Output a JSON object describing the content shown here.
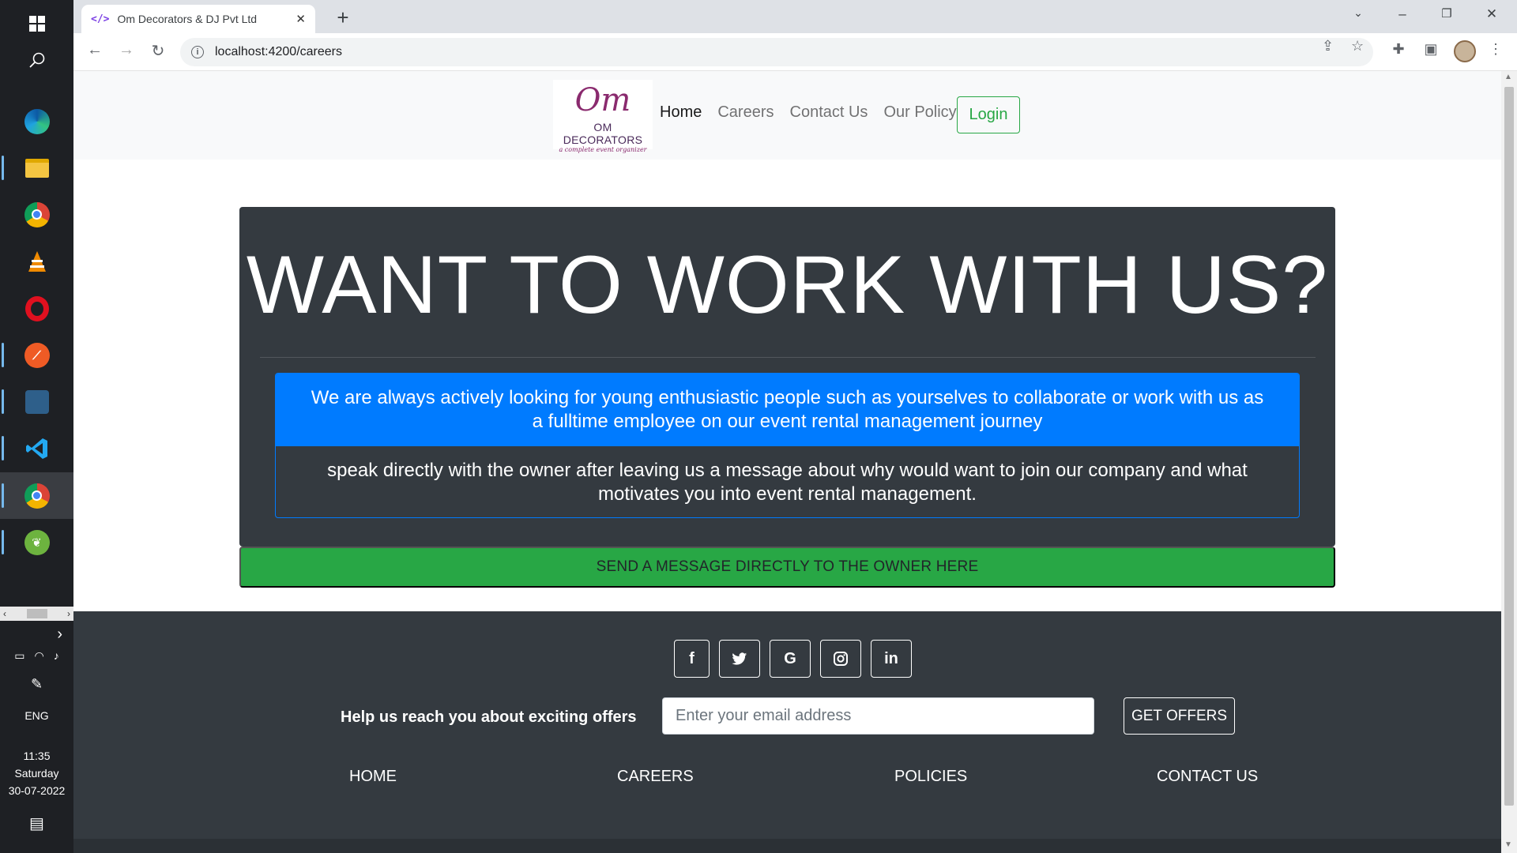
{
  "taskbar": {
    "apps": [
      {
        "name": "windows-start",
        "icon": "windows-logo-icon"
      },
      {
        "name": "search",
        "icon": "search-icon"
      },
      {
        "name": "edge",
        "icon": "edge-icon"
      },
      {
        "name": "file-explorer",
        "icon": "folder-icon"
      },
      {
        "name": "chrome",
        "icon": "chrome-icon"
      },
      {
        "name": "vlc",
        "icon": "vlc-cone-icon"
      },
      {
        "name": "opera",
        "icon": "opera-icon"
      },
      {
        "name": "postman",
        "icon": "postman-icon"
      },
      {
        "name": "mysql-workbench",
        "icon": "mysql-workbench-icon"
      },
      {
        "name": "vscode",
        "icon": "vscode-icon"
      },
      {
        "name": "chrome-active",
        "icon": "chrome-icon"
      },
      {
        "name": "spring-tool-suite",
        "icon": "spring-icon"
      }
    ],
    "language": "ENG",
    "time": "11:35",
    "day": "Saturday",
    "date": "30-07-2022"
  },
  "browser": {
    "tab_title": "Om Decorators & DJ Pvt Ltd",
    "tab_favicon": "</>",
    "url": "localhost:4200/careers"
  },
  "site": {
    "logo": {
      "mark": "Om",
      "brand": "OM DECORATORS",
      "tagline": "a complete event organizer"
    },
    "nav": {
      "home": "Home",
      "careers": "Careers",
      "contact": "Contact Us",
      "policy": "Our Policy",
      "login": "Login"
    },
    "hero": {
      "heading": "WANT TO WORK WITH US?",
      "card_header": "We are always actively looking for young enthusiastic people such as yourselves to collaborate or work with us as a fulltime employee on our event rental management journey",
      "card_body": "speak directly with the owner after leaving us a message about why would want to join our company and what motivates you into event rental management."
    },
    "cta": "SEND A MESSAGE DIRECTLY TO THE OWNER HERE",
    "footer": {
      "offers_label": "Help us reach you about exciting offers",
      "email_placeholder": "Enter your email address",
      "offers_button": "GET OFFERS",
      "social": [
        {
          "name": "facebook",
          "glyph": "f"
        },
        {
          "name": "twitter",
          "glyph": "t"
        },
        {
          "name": "google",
          "glyph": "G"
        },
        {
          "name": "instagram",
          "glyph": "◎"
        },
        {
          "name": "linkedin",
          "glyph": "in"
        }
      ],
      "links": {
        "home": "HOME",
        "careers": "CAREERS",
        "policies": "POLICIES",
        "contact": "CONTACT US"
      }
    }
  },
  "colors": {
    "dark": "#343a40",
    "primary": "#007bff",
    "success": "#28a745"
  }
}
